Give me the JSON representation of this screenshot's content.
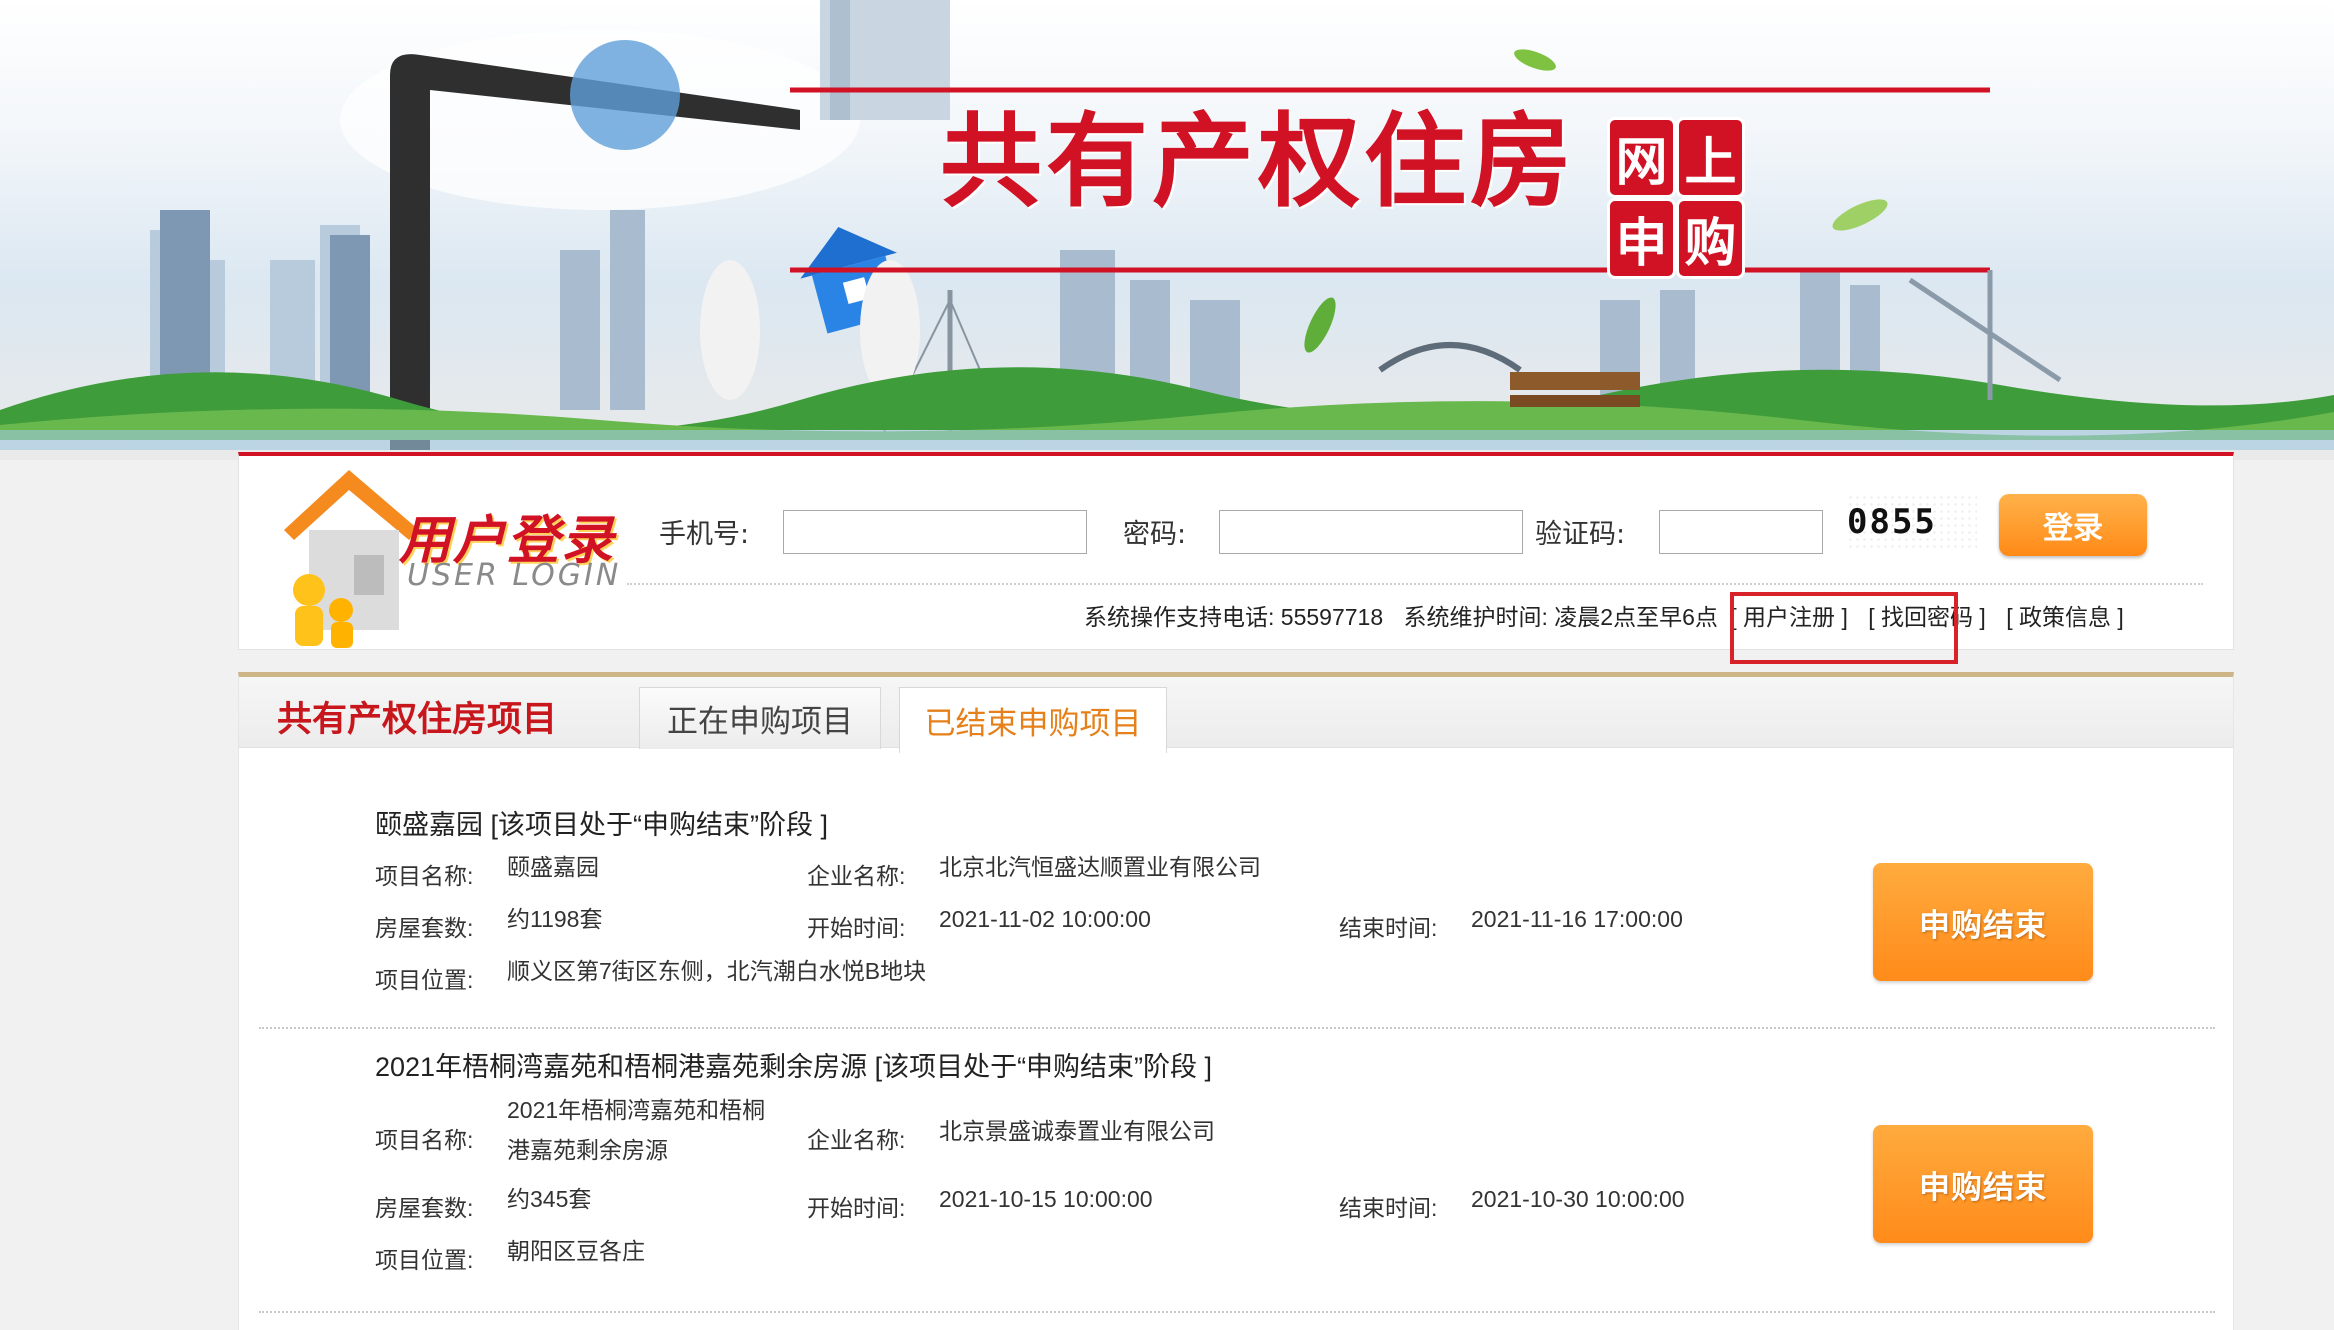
{
  "banner": {
    "title": "共有产权住房",
    "seal": [
      "网",
      "上",
      "申",
      "购"
    ]
  },
  "login": {
    "logo_title": "用户登录",
    "logo_sub": "USER LOGIN",
    "phone_label": "手机号:",
    "password_label": "密码:",
    "captcha_label": "验证码:",
    "phone_value": "",
    "password_value": "",
    "captcha_value": "",
    "captcha_code": "0855",
    "login_button": "登录",
    "support_phone": "系统操作支持电话:  55597718",
    "maintenance": "系统维护时间:  凌晨2点至早6点",
    "links": {
      "register": "[ 用户注册 ]",
      "recover": "[ 找回密码 ]",
      "policy": "[ 政策信息 ]"
    }
  },
  "projects": {
    "section_title": "共有产权住房项目",
    "tabs": [
      "正在申购项目",
      "已结束申购项目"
    ],
    "active_tab": "已结束申购项目",
    "labels": {
      "name": "项目名称:",
      "company": "企业名称:",
      "units": "房屋套数:",
      "start": "开始时间:",
      "end": "结束时间:",
      "location": "项目位置:"
    },
    "items": [
      {
        "title": "颐盛嘉园 [该项目处于“申购结束”阶段 ]",
        "name_lines": [
          "颐盛嘉园"
        ],
        "company": "北京北汽恒盛达顺置业有限公司",
        "units": "约1198套",
        "start": "2021-11-02 10:00:00",
        "end": "2021-11-16 17:00:00",
        "location": "顺义区第7街区东侧，北汽潮白水悦B地块",
        "status_button": "申购结束"
      },
      {
        "title": "2021年梧桐湾嘉苑和梧桐港嘉苑剩余房源 [该项目处于“申购结束”阶段 ]",
        "name_lines": [
          "2021年梧桐湾嘉苑和梧桐",
          "港嘉苑剩余房源"
        ],
        "company": "北京景盛诚泰置业有限公司",
        "units": "约345套",
        "start": "2021-10-15 10:00:00",
        "end": "2021-10-30 10:00:00",
        "location": "朝阳区豆各庄",
        "status_button": "申购结束"
      }
    ]
  },
  "colors": {
    "brand_red": "#d11124",
    "accent_orange": "#ff8b1a",
    "tab_active": "#e5801a",
    "highlight": "#d8222a"
  }
}
